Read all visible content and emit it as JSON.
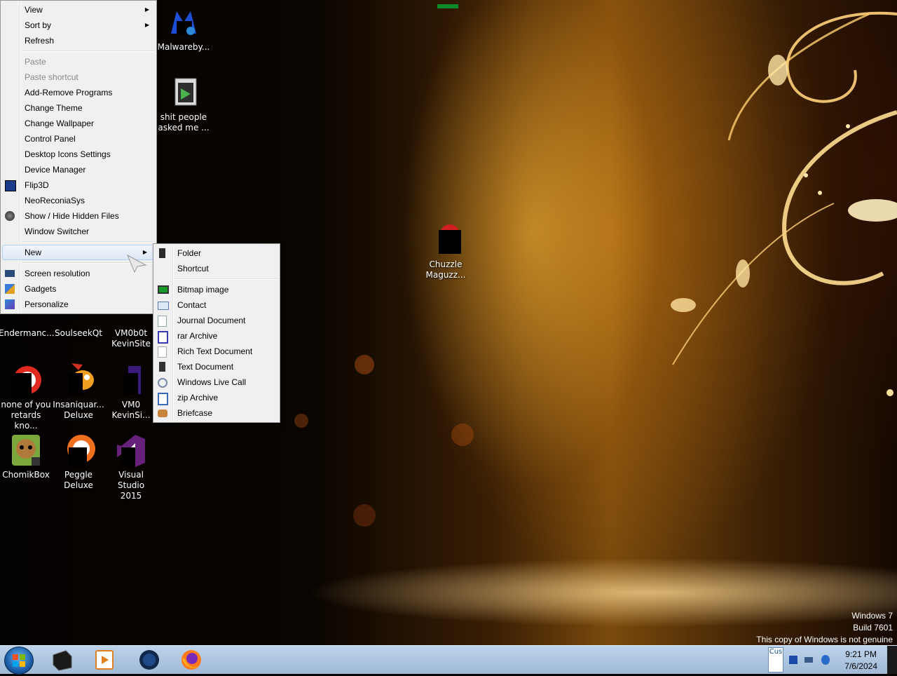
{
  "desktop_icons": [
    {
      "name": "icon-malwarebytes",
      "label": "Malwareby...",
      "icon": "malwarebytes-icon"
    },
    {
      "name": "icon-folder-people",
      "label": "shit people\nasked me ...",
      "icon": "folder-icon"
    },
    {
      "name": "icon-chuzzle",
      "label": "Chuzzle\nMaguzz...",
      "icon": "chuzzle-icon"
    },
    {
      "name": "icon-endermanch",
      "label": "Endermanc...",
      "icon": "app-icon"
    },
    {
      "name": "icon-soulseek",
      "label": "SoulseekQt",
      "icon": "app-icon"
    },
    {
      "name": "icon-vm0b0t",
      "label": "VM0b0t\nKevinSite",
      "icon": "app-icon"
    },
    {
      "name": "icon-none-of-you",
      "label": "none of you\nretards kno...",
      "icon": "app-icon"
    },
    {
      "name": "icon-insaniquarium",
      "label": "Insaniquar...\nDeluxe",
      "icon": "insaniquarium-icon"
    },
    {
      "name": "icon-vm0-kevinsi",
      "label": "VM0\nKevinSi...",
      "icon": "app-icon"
    },
    {
      "name": "icon-chomikbox",
      "label": "ChomikBox",
      "icon": "chomikbox-icon"
    },
    {
      "name": "icon-peggle",
      "label": "Peggle\nDeluxe",
      "icon": "peggle-icon"
    },
    {
      "name": "icon-visual-studio",
      "label": "Visual Studio\n2015",
      "icon": "visual-studio-icon"
    }
  ],
  "context_menu": {
    "view": "View",
    "sort_by": "Sort by",
    "refresh": "Refresh",
    "paste": "Paste",
    "paste_shortcut": "Paste shortcut",
    "add_remove_programs": "Add-Remove Programs",
    "change_theme": "Change Theme",
    "change_wallpaper": "Change Wallpaper",
    "control_panel": "Control Panel",
    "desktop_icons_settings": "Desktop Icons Settings",
    "device_manager": "Device Manager",
    "flip3d": "Flip3D",
    "neoreconiasys": "NeoReconiaSys",
    "show_hide_hidden": "Show / Hide Hidden Files",
    "window_switcher": "Window Switcher",
    "new": "New",
    "screen_resolution": "Screen resolution",
    "gadgets": "Gadgets",
    "personalize": "Personalize"
  },
  "new_submenu": {
    "folder": "Folder",
    "shortcut": "Shortcut",
    "bitmap_image": "Bitmap image",
    "contact": "Contact",
    "journal_document": "Journal Document",
    "rar_archive": "rar Archive",
    "rich_text_document": "Rich Text Document",
    "text_document": "Text Document",
    "windows_live_call": "Windows Live Call",
    "zip_archive": "zip Archive",
    "briefcase": "Briefcase"
  },
  "watermark": {
    "line1": "Windows 7",
    "line2": "Build 7601",
    "line3": "This copy of Windows is not genuine"
  },
  "taskbar": {
    "pinned": [
      "black-box-app-icon",
      "media-player-icon",
      "globe-browser-icon",
      "firefox-icon"
    ],
    "tray_label": "Cus",
    "time": "9:21 PM",
    "date": "7/6/2024"
  },
  "colors": {
    "taskbar": "#a9c3df",
    "menu_bg": "#f0f0f0",
    "menu_highlight": "#dde9f7",
    "wallpaper_gold": "#ffc040"
  }
}
